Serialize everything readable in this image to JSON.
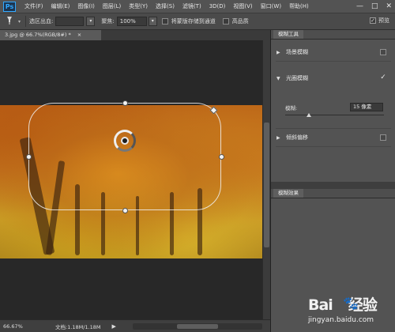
{
  "app": {
    "logo": "Ps"
  },
  "menubar": {
    "items": [
      "文件(F)",
      "编辑(E)",
      "图像(I)",
      "图层(L)",
      "类型(Y)",
      "选择(S)",
      "滤镜(T)",
      "3D(D)",
      "视图(V)",
      "窗口(W)",
      "帮助(H)"
    ],
    "window_controls": [
      "—",
      "□",
      "✕"
    ]
  },
  "options_bar": {
    "tool_icon": "pin-icon",
    "selection_label": "选区出血:",
    "selection_value": "",
    "focus_label": "聚焦:",
    "focus_value": "100%",
    "save_mask_label": "将蒙版存储到通道",
    "high_quality_label": "高品质",
    "preview_label": "预览",
    "preview_checked": true
  },
  "document": {
    "tab_title": "3.jpg @ 66.7%(RGB/8#) *",
    "close_glyph": "×"
  },
  "blur_tools": {
    "tab_label": "模糊工具",
    "rows": [
      {
        "label": "场景模糊",
        "expanded": false,
        "checked": false
      },
      {
        "label": "光圈模糊",
        "expanded": true,
        "checked": true
      },
      {
        "label": "倾斜偏移",
        "expanded": false,
        "checked": false
      }
    ],
    "blur_label": "模糊:",
    "blur_value": "15 像素",
    "blur_fraction": 0.24
  },
  "blur_effects": {
    "tab_label": "模糊效果"
  },
  "status": {
    "zoom": "66.67%",
    "doc_info": "文档:1.18M/1.18M",
    "arrow": "▶"
  },
  "watermark": {
    "logo": "Bai",
    "logo_suffix": "经验",
    "url": "jingyan.baidu.com"
  }
}
